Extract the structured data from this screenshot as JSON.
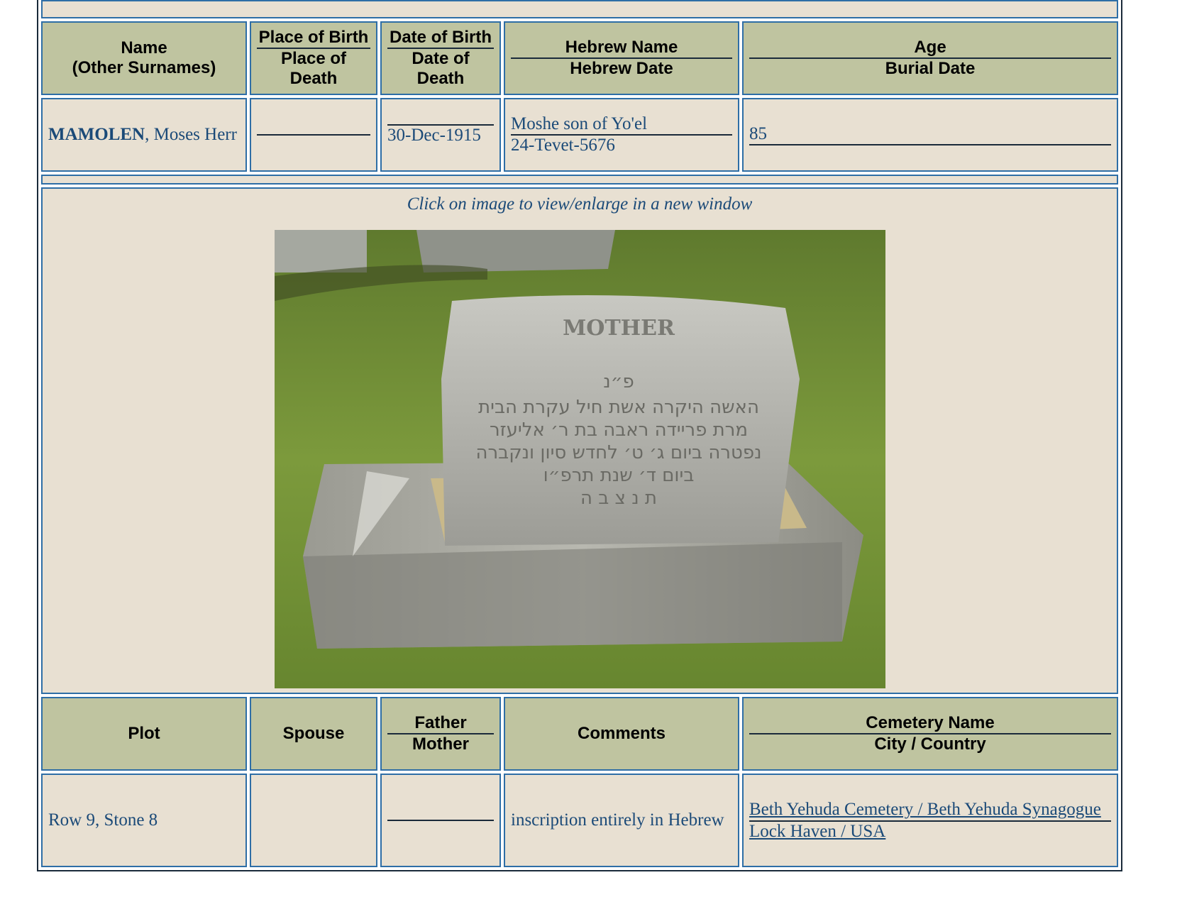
{
  "header_row_1": {
    "name": "Name",
    "other_surnames": "(Other Surnames)",
    "place_of_birth": "Place of Birth",
    "place_of_death": "Place of Death",
    "date_of_birth": "Date of Birth",
    "date_of_death": "Date of Death",
    "hebrew_name": "Hebrew Name",
    "hebrew_date": "Hebrew Date",
    "age": "Age",
    "burial_date": "Burial Date"
  },
  "record": {
    "surname": "MAMOLEN",
    "given_names": ", Moses Herr",
    "place_of_birth": "",
    "place_of_death": "",
    "date_of_birth": "",
    "date_of_death": "30-Dec-1915",
    "hebrew_name": "Moshe son of Yo'el",
    "hebrew_date": "24-Tevet-5676",
    "age": "85",
    "burial_date": ""
  },
  "photo_caption": "Click on image to view/enlarge in a new window",
  "stone_inscription": {
    "title": "MOTHER",
    "lines": [
      "פ״נ",
      "האשה היקרה אשת חיל עקרת הבית",
      "מרת פריידה ראבה בת ר׳ אליעזר",
      "נפטרה ביום ג׳ ט׳ לחדש סיון ונקברה",
      "ביום ד׳ שנת תרפ״ו",
      "ת נ צ ב ה"
    ]
  },
  "header_row_2": {
    "plot": "Plot",
    "spouse": "Spouse",
    "father": "Father",
    "mother": "Mother",
    "comments": "Comments",
    "cemetery_name": "Cemetery Name",
    "city_country": "City / Country"
  },
  "record_2": {
    "plot": "Row 9, Stone 8",
    "spouse": "",
    "father": "",
    "mother": "",
    "comments": "inscription entirely in Hebrew",
    "cemetery_name": "Beth Yehuda Cemetery / Beth Yehuda Synagogue",
    "city_country": "Lock Haven / USA"
  },
  "colors": {
    "header_bg": "#bfc4a0",
    "cell_bg": "#e8e0d2",
    "cell_border": "#2e6ea6",
    "text": "#1b4a78"
  }
}
